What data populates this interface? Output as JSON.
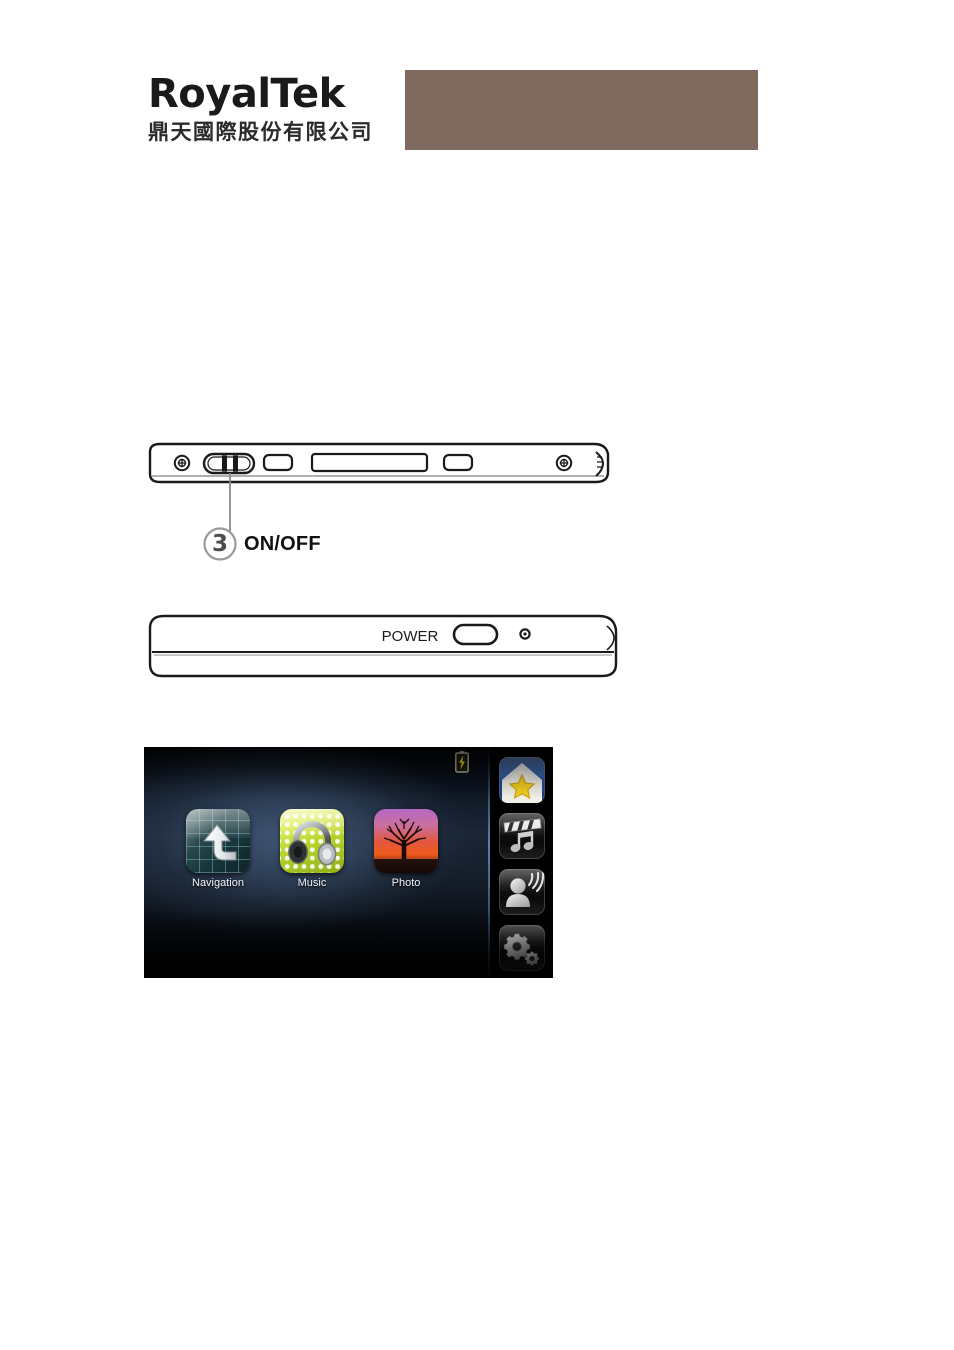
{
  "header": {
    "logo_wordmark": "RoyalTek",
    "logo_subtitle": "鼎天國際股份有限公司",
    "band_color": "#7e6a5e"
  },
  "figures": [
    {
      "id": "device-bottom-edge",
      "callout_number": "3",
      "callout_label": "ON/OFF",
      "parts": [
        "screw",
        "slide-switch",
        "port",
        "slot",
        "port",
        "screw"
      ]
    },
    {
      "id": "device-top-edge",
      "power_label": "POWER",
      "parts": [
        "power-button",
        "led-indicator"
      ]
    }
  ],
  "device_screen": {
    "status": {
      "battery": "charging"
    },
    "apps": [
      {
        "label": "Navigation",
        "icon": "navigation-icon"
      },
      {
        "label": "Music",
        "icon": "music-icon"
      },
      {
        "label": "Photo",
        "icon": "photo-icon"
      }
    ],
    "sidebar": [
      {
        "name": "home-favorite",
        "icon": "house-star-icon"
      },
      {
        "name": "media",
        "icon": "clapperboard-music-icon"
      },
      {
        "name": "voice",
        "icon": "voice-command-icon"
      },
      {
        "name": "settings",
        "icon": "gears-icon"
      }
    ],
    "colors": {
      "background_top": "#010204",
      "background_mid": "#1b2636",
      "sidebar": "#000000",
      "label_text": "#f2f5f8",
      "star": "#f5d020",
      "music_tile": "#b5d12a",
      "nav_tile": "#27484d"
    }
  }
}
